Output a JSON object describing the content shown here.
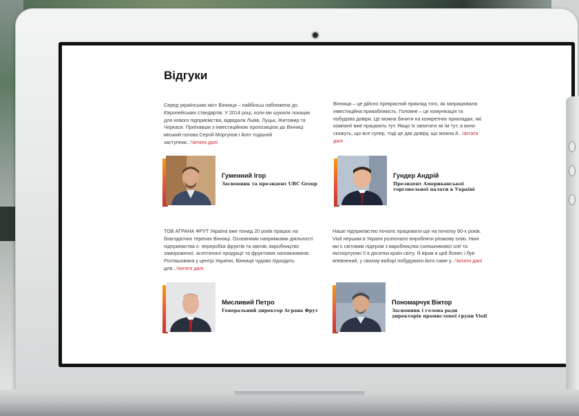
{
  "page": {
    "title": "Відгуки"
  },
  "reviews": [
    {
      "text": "Серед українських міст Вінниця – найбільш наближена до Європейських стандартів. У 2014 році, коли ми шукали локацію для нового підприємства, відвідали Львів, Луцьк, Житомир та Черкаси. Приїхавши з інвестиційною пропозицією до Вінниці міський голова Сергій Моргунов і його тодішній заступник...",
      "read_more": "Читати далі",
      "name": "Гуменний Ігор",
      "role": "Засновник та президент UBC Group"
    },
    {
      "text": "Вінниця – це дійсно прекрасний приклад того, як запрацювала інвестиційна привабливість. Головне – це комунікація та побудова довіри. Це можна бачити на конкретних прикладах, які компанії вже працюють тут. Якщо їх запитати як їм тут, а вони скажуть, що все супер, тоді це дає довіру, що можна й...",
      "read_more": "Читати далі",
      "name": "Гундер Андрій",
      "role": "Президент Американської торговельної палати в Україні"
    },
    {
      "text": "ТОВ АГРАНА ФРУТ Україна вже понад 20 років працює на благодатних теренах Вінниці. Основними напрямками діяльності підприємства є: переробка фруктів та овочів, виробництво замороженої, асептичної продукції та фруктових наповнювачів. Розташована у центрі України, Вінниця чудово підходить для...",
      "read_more": "Читати далі",
      "name": "Мисливий Петро",
      "role": "Генеральний директор Аграна Фрут"
    },
    {
      "text": "Наше підприємство почало працювати ще на початку 90-х років. Vioil першим в Україні розпочало виробляти ріпакову олію. Нині ми є світовим лідером з виробництва соняшникової олії та експортуємо її в десятки країн світу. Я вірив в цей бізнес і був впевнений, у своєму виборі побудувати його саме у...",
      "read_more": "Читати далі",
      "name": "Пономарчук Віктор",
      "role": "Засновник і голова ради директорів промислової групи Vioil"
    }
  ],
  "colors": {
    "accent": "#c8242c",
    "photo_accent_top": "#f39c12",
    "photo_accent_bottom": "#c0392b"
  },
  "icons": {
    "camera": "camera-icon"
  }
}
